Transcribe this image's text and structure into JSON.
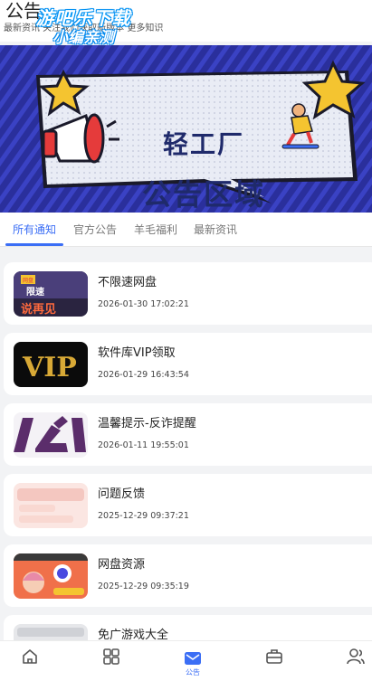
{
  "header": {
    "title": "公告",
    "subline": "最新资讯 关注我们获取新版本 更多知识",
    "watermark_line1": "游吧乐下载",
    "watermark_line2": "小编亲测"
  },
  "banner": {
    "title": "轻工厂",
    "subtitle": "公告区域",
    "colors": {
      "background": "#2a2f9c",
      "board": "#e9ecf5",
      "text": "#1f2a6b",
      "star": "#f4c430"
    }
  },
  "tabs": [
    {
      "label": "所有通知",
      "active": true
    },
    {
      "label": "官方公告",
      "active": false
    },
    {
      "label": "羊毛福利",
      "active": false
    },
    {
      "label": "最新资讯",
      "active": false
    }
  ],
  "items": [
    {
      "title": "不限速网盘",
      "time": "2026-01-30 17:02:21",
      "thumb": "unlimited-speed-thumb",
      "thumb_text": "限速",
      "thumb_text2": "说再见",
      "thumb_tag": "网盘"
    },
    {
      "title": "软件库VIP领取",
      "time": "2026-01-29 16:43:54",
      "thumb": "vip-thumb",
      "thumb_text": "VIP"
    },
    {
      "title": "温馨提示-反诈提醒",
      "time": "2026-01-11 19:55:01",
      "thumb": "anti-fraud-thumb"
    },
    {
      "title": "问题反馈",
      "time": "2025-12-29 09:37:21",
      "thumb": "feedback-thumb"
    },
    {
      "title": "网盘资源",
      "time": "2025-12-29 09:35:19",
      "thumb": "netdisk-thumb"
    },
    {
      "title": "免广游戏大全",
      "time": "",
      "thumb": "games-thumb"
    }
  ],
  "nav": {
    "items": [
      {
        "icon": "home-icon",
        "label": ""
      },
      {
        "icon": "grid-icon",
        "label": ""
      },
      {
        "icon": "mail-icon",
        "label": "公告",
        "active": true
      },
      {
        "icon": "toolbox-icon",
        "label": ""
      },
      {
        "icon": "user-icon",
        "label": ""
      }
    ],
    "accent": "#3b6ef5"
  }
}
